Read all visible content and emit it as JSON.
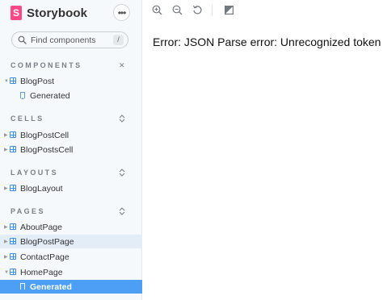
{
  "app": {
    "logo_letter": "S",
    "name": "Storybook",
    "menu_label": "•••"
  },
  "search": {
    "placeholder": "Find components",
    "shortcut": "/"
  },
  "sidebar": {
    "sections": [
      {
        "title": "COMPONENTS",
        "toggle": "✕"
      },
      {
        "title": "CELLS",
        "toggle": "⌃"
      },
      {
        "title": "LAYOUTS",
        "toggle": "⌃"
      },
      {
        "title": "PAGES",
        "toggle": "⌃"
      }
    ],
    "items": {
      "blogpost": "BlogPost",
      "blogpost_generated": "Generated",
      "blogpostcell": "BlogPostCell",
      "blogpostscell": "BlogPostsCell",
      "bloglayout": "BlogLayout",
      "aboutpage": "AboutPage",
      "blogpostpage": "BlogPostPage",
      "contactpage": "ContactPage",
      "homepage": "HomePage",
      "homepage_generated": "Generated"
    }
  },
  "toolbar": {
    "icons": [
      "zoom-in-icon",
      "zoom-out-icon",
      "zoom-reset-icon",
      "background-icon"
    ]
  },
  "canvas": {
    "error_message": "Error: JSON Parse error: Unrecognized token '<'"
  },
  "colors": {
    "brand": "#ff4785",
    "selected": "#4d9ff6",
    "component_icon": "#3b8ee8"
  }
}
